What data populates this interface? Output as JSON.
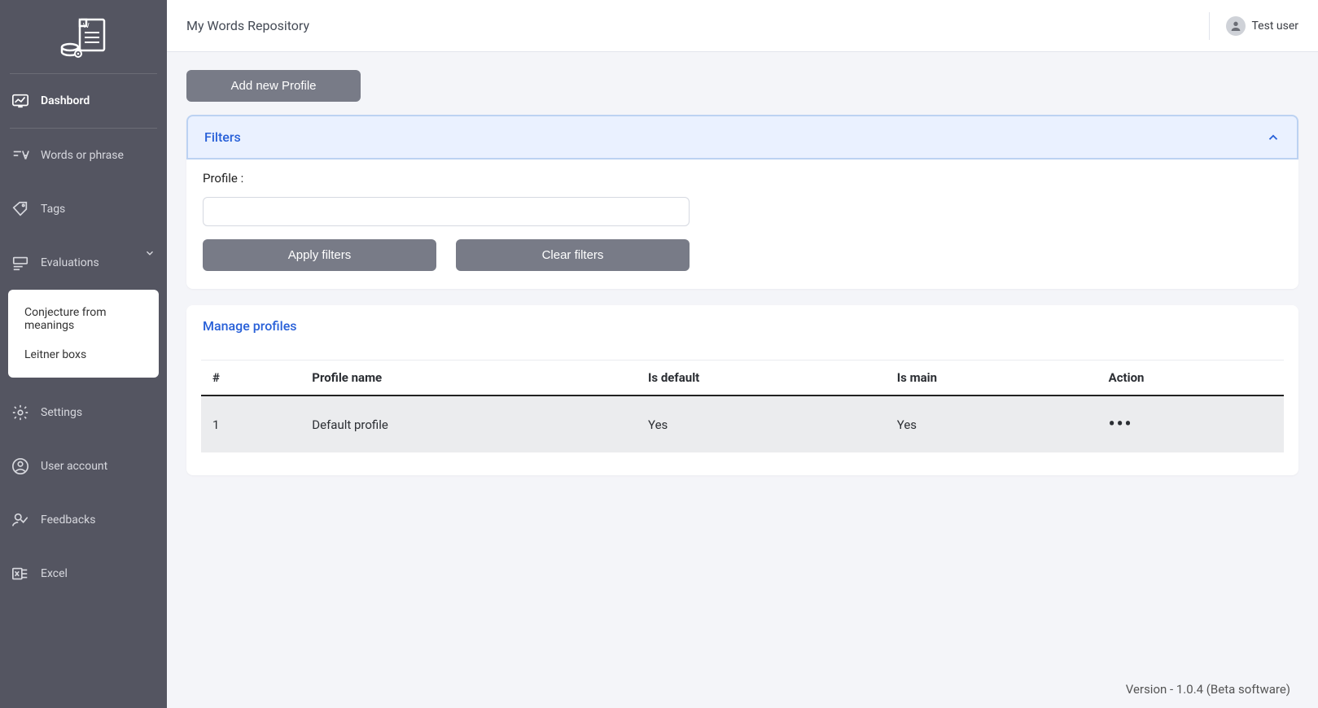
{
  "header": {
    "title": "My Words Repository",
    "user_name": "Test user"
  },
  "sidebar": {
    "dashboard": "Dashbord",
    "words": "Words or phrase",
    "tags": "Tags",
    "evaluations": "Evaluations",
    "evaluations_sub": {
      "conjecture": "Conjecture from meanings",
      "leitner": "Leitner boxs"
    },
    "settings": "Settings",
    "user_account": "User account",
    "feedbacks": "Feedbacks",
    "excel": "Excel"
  },
  "buttons": {
    "add_profile": "Add new Profile",
    "apply_filters": "Apply filters",
    "clear_filters": "Clear filters"
  },
  "filters": {
    "panel_title": "Filters",
    "profile_label": "Profile :",
    "profile_value": ""
  },
  "manage": {
    "title": "Manage profiles",
    "columns": {
      "num": "#",
      "name": "Profile name",
      "is_default": "Is default",
      "is_main": "Is main",
      "action": "Action"
    },
    "rows": [
      {
        "num": "1",
        "name": "Default profile",
        "is_default": "Yes",
        "is_main": "Yes"
      }
    ]
  },
  "footer": {
    "version": "Version - 1.0.4 (Beta software)"
  }
}
